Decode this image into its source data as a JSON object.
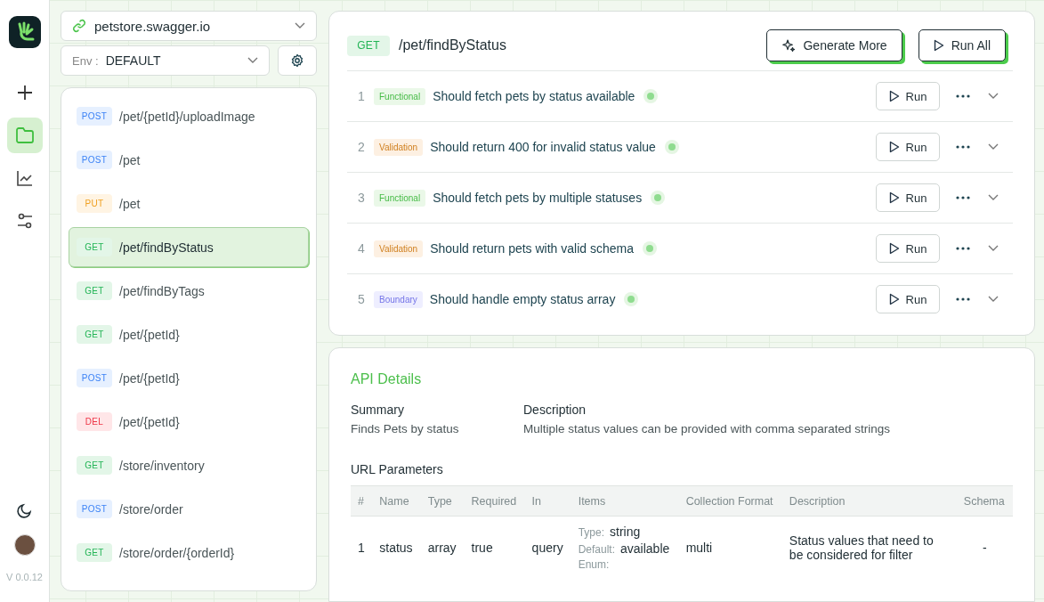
{
  "rail": {
    "items": [
      {
        "kind": "add",
        "selected": false
      },
      {
        "kind": "folder",
        "selected": true
      },
      {
        "kind": "chart",
        "selected": false
      },
      {
        "kind": "sliders",
        "selected": false
      }
    ],
    "version": "V 0.0.12"
  },
  "sidebar": {
    "host": "petstore.swagger.io",
    "env_label": "Env :",
    "env_value": "DEFAULT",
    "endpoints": [
      {
        "method": "POST",
        "kind": "post",
        "path": "/pet/{petId}/uploadImage",
        "selected": false
      },
      {
        "method": "POST",
        "kind": "post",
        "path": "/pet",
        "selected": false
      },
      {
        "method": "PUT",
        "kind": "put",
        "path": "/pet",
        "selected": false
      },
      {
        "method": "GET",
        "kind": "get",
        "path": "/pet/findByStatus",
        "selected": true
      },
      {
        "method": "GET",
        "kind": "get",
        "path": "/pet/findByTags",
        "selected": false
      },
      {
        "method": "GET",
        "kind": "get",
        "path": "/pet/{petId}",
        "selected": false
      },
      {
        "method": "POST",
        "kind": "post",
        "path": "/pet/{petId}",
        "selected": false
      },
      {
        "method": "DEL",
        "kind": "delete",
        "path": "/pet/{petId}",
        "selected": false
      },
      {
        "method": "GET",
        "kind": "get",
        "path": "/store/inventory",
        "selected": false
      },
      {
        "method": "POST",
        "kind": "post",
        "path": "/store/order",
        "selected": false
      },
      {
        "method": "GET",
        "kind": "get",
        "path": "/store/order/{orderId}",
        "selected": false
      }
    ]
  },
  "endpoint": {
    "method": "GET",
    "path": "/pet/findByStatus",
    "buttons": [
      "Generate More",
      "Run All"
    ],
    "tests": [
      {
        "number": "1",
        "tag": "Functional",
        "kind": "functional",
        "title": "Should fetch pets by status available",
        "color": "#8fdc8f",
        "run": "Run"
      },
      {
        "number": "2",
        "tag": "Validation",
        "kind": "validation",
        "title": "Should return 400 for invalid status value",
        "color": "#8fdc8f",
        "run": "Run"
      },
      {
        "number": "3",
        "tag": "Functional",
        "kind": "functional",
        "title": "Should fetch pets by multiple statuses",
        "color": "#8fdc8f",
        "run": "Run"
      },
      {
        "number": "4",
        "tag": "Validation",
        "kind": "validation",
        "title": "Should return pets with valid schema",
        "color": "#8fdc8f",
        "run": "Run"
      },
      {
        "number": "5",
        "tag": "Boundary",
        "kind": "boundary",
        "title": "Should handle empty status array",
        "color": "#8fdc8f",
        "run": "Run"
      }
    ]
  },
  "details": {
    "title": "API Details",
    "summary_label": "Summary",
    "summary": "Finds Pets by status",
    "description_label": "Description",
    "description": "Multiple status values can be provided with comma separated strings",
    "params_title": "URL Parameters",
    "table": {
      "columns": [
        "#",
        "Name",
        "Type",
        "Required",
        "In",
        "Items",
        "Collection Format",
        "Description",
        "Schema"
      ],
      "rows": [
        {
          "number": "1",
          "name": "status",
          "type": "array",
          "required": "true",
          "in": "query",
          "items": [
            {
              "label": "Type:",
              "value": "string"
            },
            {
              "label": "Default:",
              "value": "available"
            },
            {
              "label": "Enum:"
            }
          ],
          "collection_format": "multi",
          "description": "Status values that need to be considered for filter",
          "schema": "-"
        }
      ]
    }
  }
}
